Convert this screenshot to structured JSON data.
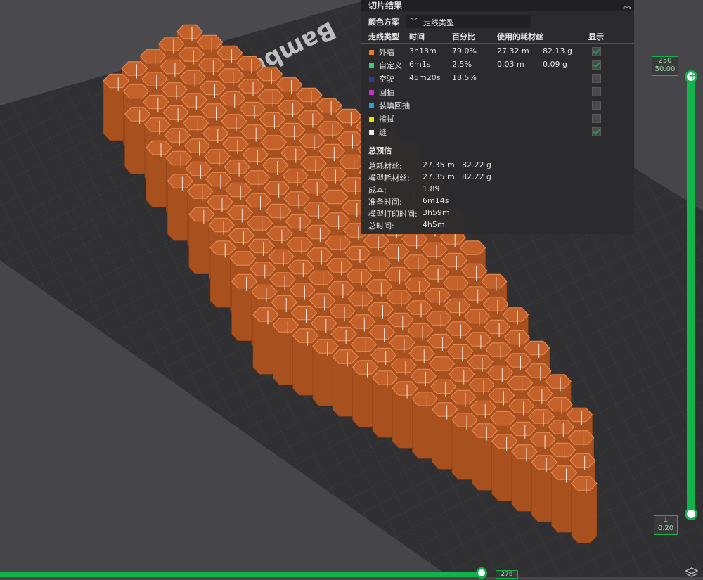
{
  "scene": {
    "plate_label": "Bambu   Plate",
    "model_color": "#c4602a",
    "plate_color": "#303033"
  },
  "panel": {
    "title": "切片结果",
    "collapse_icon": "chevrons-up-icon",
    "color_scheme_label": "颜色方案",
    "color_scheme_value": "走线类型",
    "columns": [
      "走线类型",
      "时间",
      "百分比",
      "使用的耗材丝",
      "",
      "显示"
    ],
    "rows": [
      {
        "color": "#f37c2a",
        "type": "外墙",
        "time": "3h13m",
        "percent": "79.0%",
        "length": "27.32 m",
        "weight": "82.13 g",
        "shown": true
      },
      {
        "color": "#3dcf7a",
        "type": "自定义",
        "time": "6m1s",
        "percent": "2.5%",
        "length": "0.03 m",
        "weight": "0.09 g",
        "shown": true
      },
      {
        "color": "#2e3a9e",
        "type": "空驶",
        "time": "45m20s",
        "percent": "18.5%",
        "length": "",
        "weight": "",
        "shown": false
      },
      {
        "color": "#d12fc8",
        "type": "回抽",
        "time": "",
        "percent": "",
        "length": "",
        "weight": "",
        "shown": false
      },
      {
        "color": "#2aa3d6",
        "type": "装填回抽",
        "time": "",
        "percent": "",
        "length": "",
        "weight": "",
        "shown": false
      },
      {
        "color": "#f2e400",
        "type": "擦拭",
        "time": "",
        "percent": "",
        "length": "",
        "weight": "",
        "shown": false
      },
      {
        "color": "#f2f2f2",
        "type": "缝",
        "time": "",
        "percent": "",
        "length": "",
        "weight": "",
        "shown": true
      }
    ],
    "estimate_title": "总预估",
    "estimates": [
      {
        "label": "总耗材丝:",
        "v1": "27.35 m",
        "v2": "82.22 g"
      },
      {
        "label": "模型耗材丝:",
        "v1": "27.35 m",
        "v2": "82.22 g"
      },
      {
        "label": "成本:",
        "v1": "1.89",
        "v2": ""
      },
      {
        "label": "准备时间:",
        "v1": "6m14s",
        "v2": ""
      },
      {
        "label": "模型打印时间:",
        "v1": "3h59m",
        "v2": ""
      },
      {
        "label": "总时间:",
        "v1": "4h5m",
        "v2": ""
      }
    ]
  },
  "layer_slider": {
    "top_layer": "250",
    "top_height": "50.00",
    "bottom_layer": "1",
    "bottom_height": "0.20"
  },
  "move_slider": {
    "value": "276"
  },
  "icons": {
    "layers": "layers-icon"
  }
}
